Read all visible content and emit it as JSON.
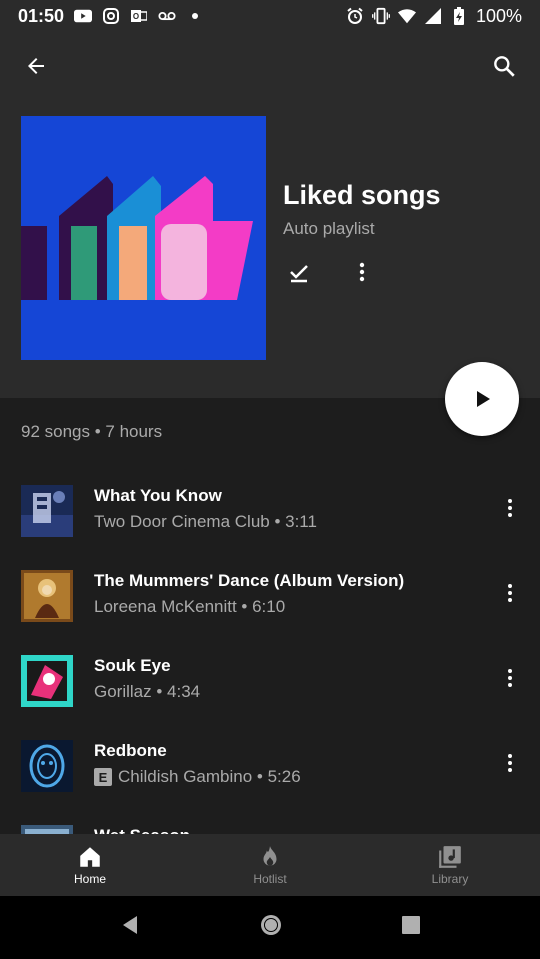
{
  "status_bar": {
    "time": "01:50",
    "battery": "100%",
    "left_icons": [
      "youtube-icon",
      "instagram-icon",
      "outlook-icon",
      "voicemail-icon",
      "dot-icon"
    ],
    "right_icons": [
      "alarm-icon",
      "vibrate-icon",
      "wifi-icon",
      "signal-icon",
      "battery-icon"
    ]
  },
  "header": {
    "title": "Liked songs",
    "subtitle": "Auto playlist"
  },
  "summary": "92 songs • 7 hours",
  "songs": [
    {
      "title": "What You Know",
      "subtitle": "Two Door Cinema Club • 3:11",
      "explicit": false
    },
    {
      "title": "The Mummers' Dance (Album Version)",
      "subtitle": "Loreena McKennitt • 6:10",
      "explicit": false
    },
    {
      "title": "Souk Eye",
      "subtitle": "Gorillaz • 4:34",
      "explicit": false
    },
    {
      "title": "Redbone",
      "subtitle": "Childish Gambino • 5:26",
      "explicit": true,
      "explicit_label": "E"
    },
    {
      "title": "Wet Season",
      "subtitle": "",
      "explicit": false
    }
  ],
  "bottom_nav": [
    {
      "label": "Home",
      "active": true
    },
    {
      "label": "Hotlist",
      "active": false
    },
    {
      "label": "Library",
      "active": false
    }
  ],
  "colors": {
    "background": "#1d1d1d",
    "header_bg": "#2b2b2b",
    "cover_bg": "#1546d6",
    "secondary_text": "#aaaaaa"
  }
}
